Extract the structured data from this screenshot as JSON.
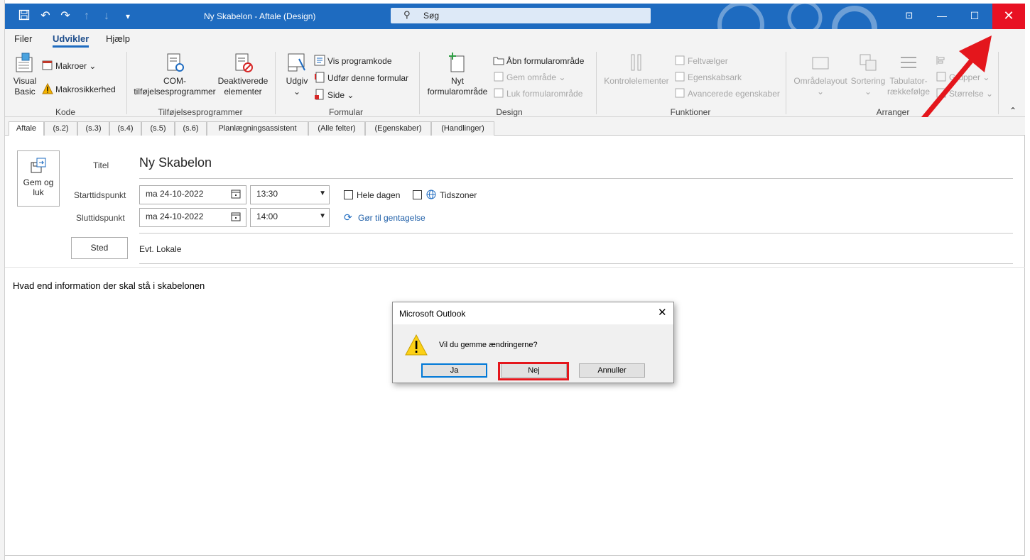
{
  "window": {
    "title": "Ny Skabelon  -  Aftale  (Design)",
    "search_placeholder": "Søg"
  },
  "menu": {
    "tabs": [
      "Filer",
      "Udvikler",
      "Hjælp"
    ],
    "active": "Udvikler"
  },
  "ribbon": {
    "kode": {
      "visual_basic": [
        "Visual",
        "Basic"
      ],
      "makroer": "Makroer",
      "makrosikkerhed": "Makrosikkerhed",
      "label": "Kode"
    },
    "tilfoj": {
      "com": [
        "COM-",
        "tilføjelsesprogrammer"
      ],
      "deaktiverede": [
        "Deaktiverede",
        "elementer"
      ],
      "label": "Tilføjelsesprogrammer"
    },
    "formular": {
      "udgiv": "Udgiv",
      "vis_programkode": "Vis programkode",
      "udfor": "Udfør denne formular",
      "side": "Side",
      "label": "Formular"
    },
    "design": {
      "nyt": [
        "Nyt",
        "formularområde"
      ],
      "abn": "Åbn formularområde",
      "gem": "Gem område",
      "luk": "Luk formularområde",
      "label": "Design"
    },
    "funktioner": {
      "kontrol": "Kontrolelementer",
      "feltvaelger": "Feltvælger",
      "egenskabsark": "Egenskabsark",
      "avancerede": "Avancerede egenskaber",
      "label": "Funktioner"
    },
    "arranger": {
      "omradelayout": "Områdelayout",
      "sortering": "Sortering",
      "tabulator": [
        "Tabulator-",
        "rækkefølge"
      ],
      "grupper": "Grupper",
      "storrelse": "Størrelse",
      "label": "Arranger"
    }
  },
  "form_tabs": [
    "Aftale",
    "(s.2)",
    "(s.3)",
    "(s.4)",
    "(s.5)",
    "(s.6)",
    "Planlægningsassistent",
    "(Alle felter)",
    "(Egenskaber)",
    "(Handlinger)"
  ],
  "form": {
    "gem_og_luk": [
      "Gem og",
      "luk"
    ],
    "titel_label": "Titel",
    "titel_value": "Ny Skabelon",
    "start_label": "Starttidspunkt",
    "start_date": "ma 24-10-2022",
    "start_time": "13:30",
    "slut_label": "Sluttidspunkt",
    "slut_date": "ma 24-10-2022",
    "slut_time": "14:00",
    "hele_dagen": "Hele dagen",
    "tidszoner": "Tidszoner",
    "gentagelse": "Gør til gentagelse",
    "sted_button": "Sted",
    "sted_value": "Evt. Lokale",
    "body_text": "Hvad end information der skal stå i skabelonen"
  },
  "dialog": {
    "title": "Microsoft Outlook",
    "message": "Vil du gemme ændringerne?",
    "buttons": [
      "Ja",
      "Nej",
      "Annuller"
    ]
  },
  "colors": {
    "titlebar": "#1e6bc0",
    "close": "#e81123",
    "annotation": "#e4161c"
  }
}
